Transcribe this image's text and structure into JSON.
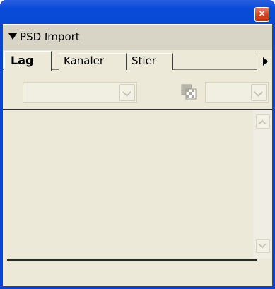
{
  "window": {
    "close_glyph": "✕"
  },
  "panel": {
    "title": "PSD Import",
    "collapse_icon": "triangle-down-icon"
  },
  "tabs": [
    {
      "label": "Lag",
      "active": true
    },
    {
      "label": "Kanaler",
      "active": false
    },
    {
      "label": "Stier",
      "active": false
    }
  ],
  "toolbar": {
    "layer_dropdown_value": "",
    "blend_icon": "blend-mode-icon",
    "opacity_dropdown_value": ""
  },
  "colors": {
    "titlebar": "#0846d0",
    "close_button": "#d4411c",
    "panel_bg": "#ece9d8",
    "panel_header_bg": "#d8d5c7",
    "divider": "#2b2b2b"
  }
}
